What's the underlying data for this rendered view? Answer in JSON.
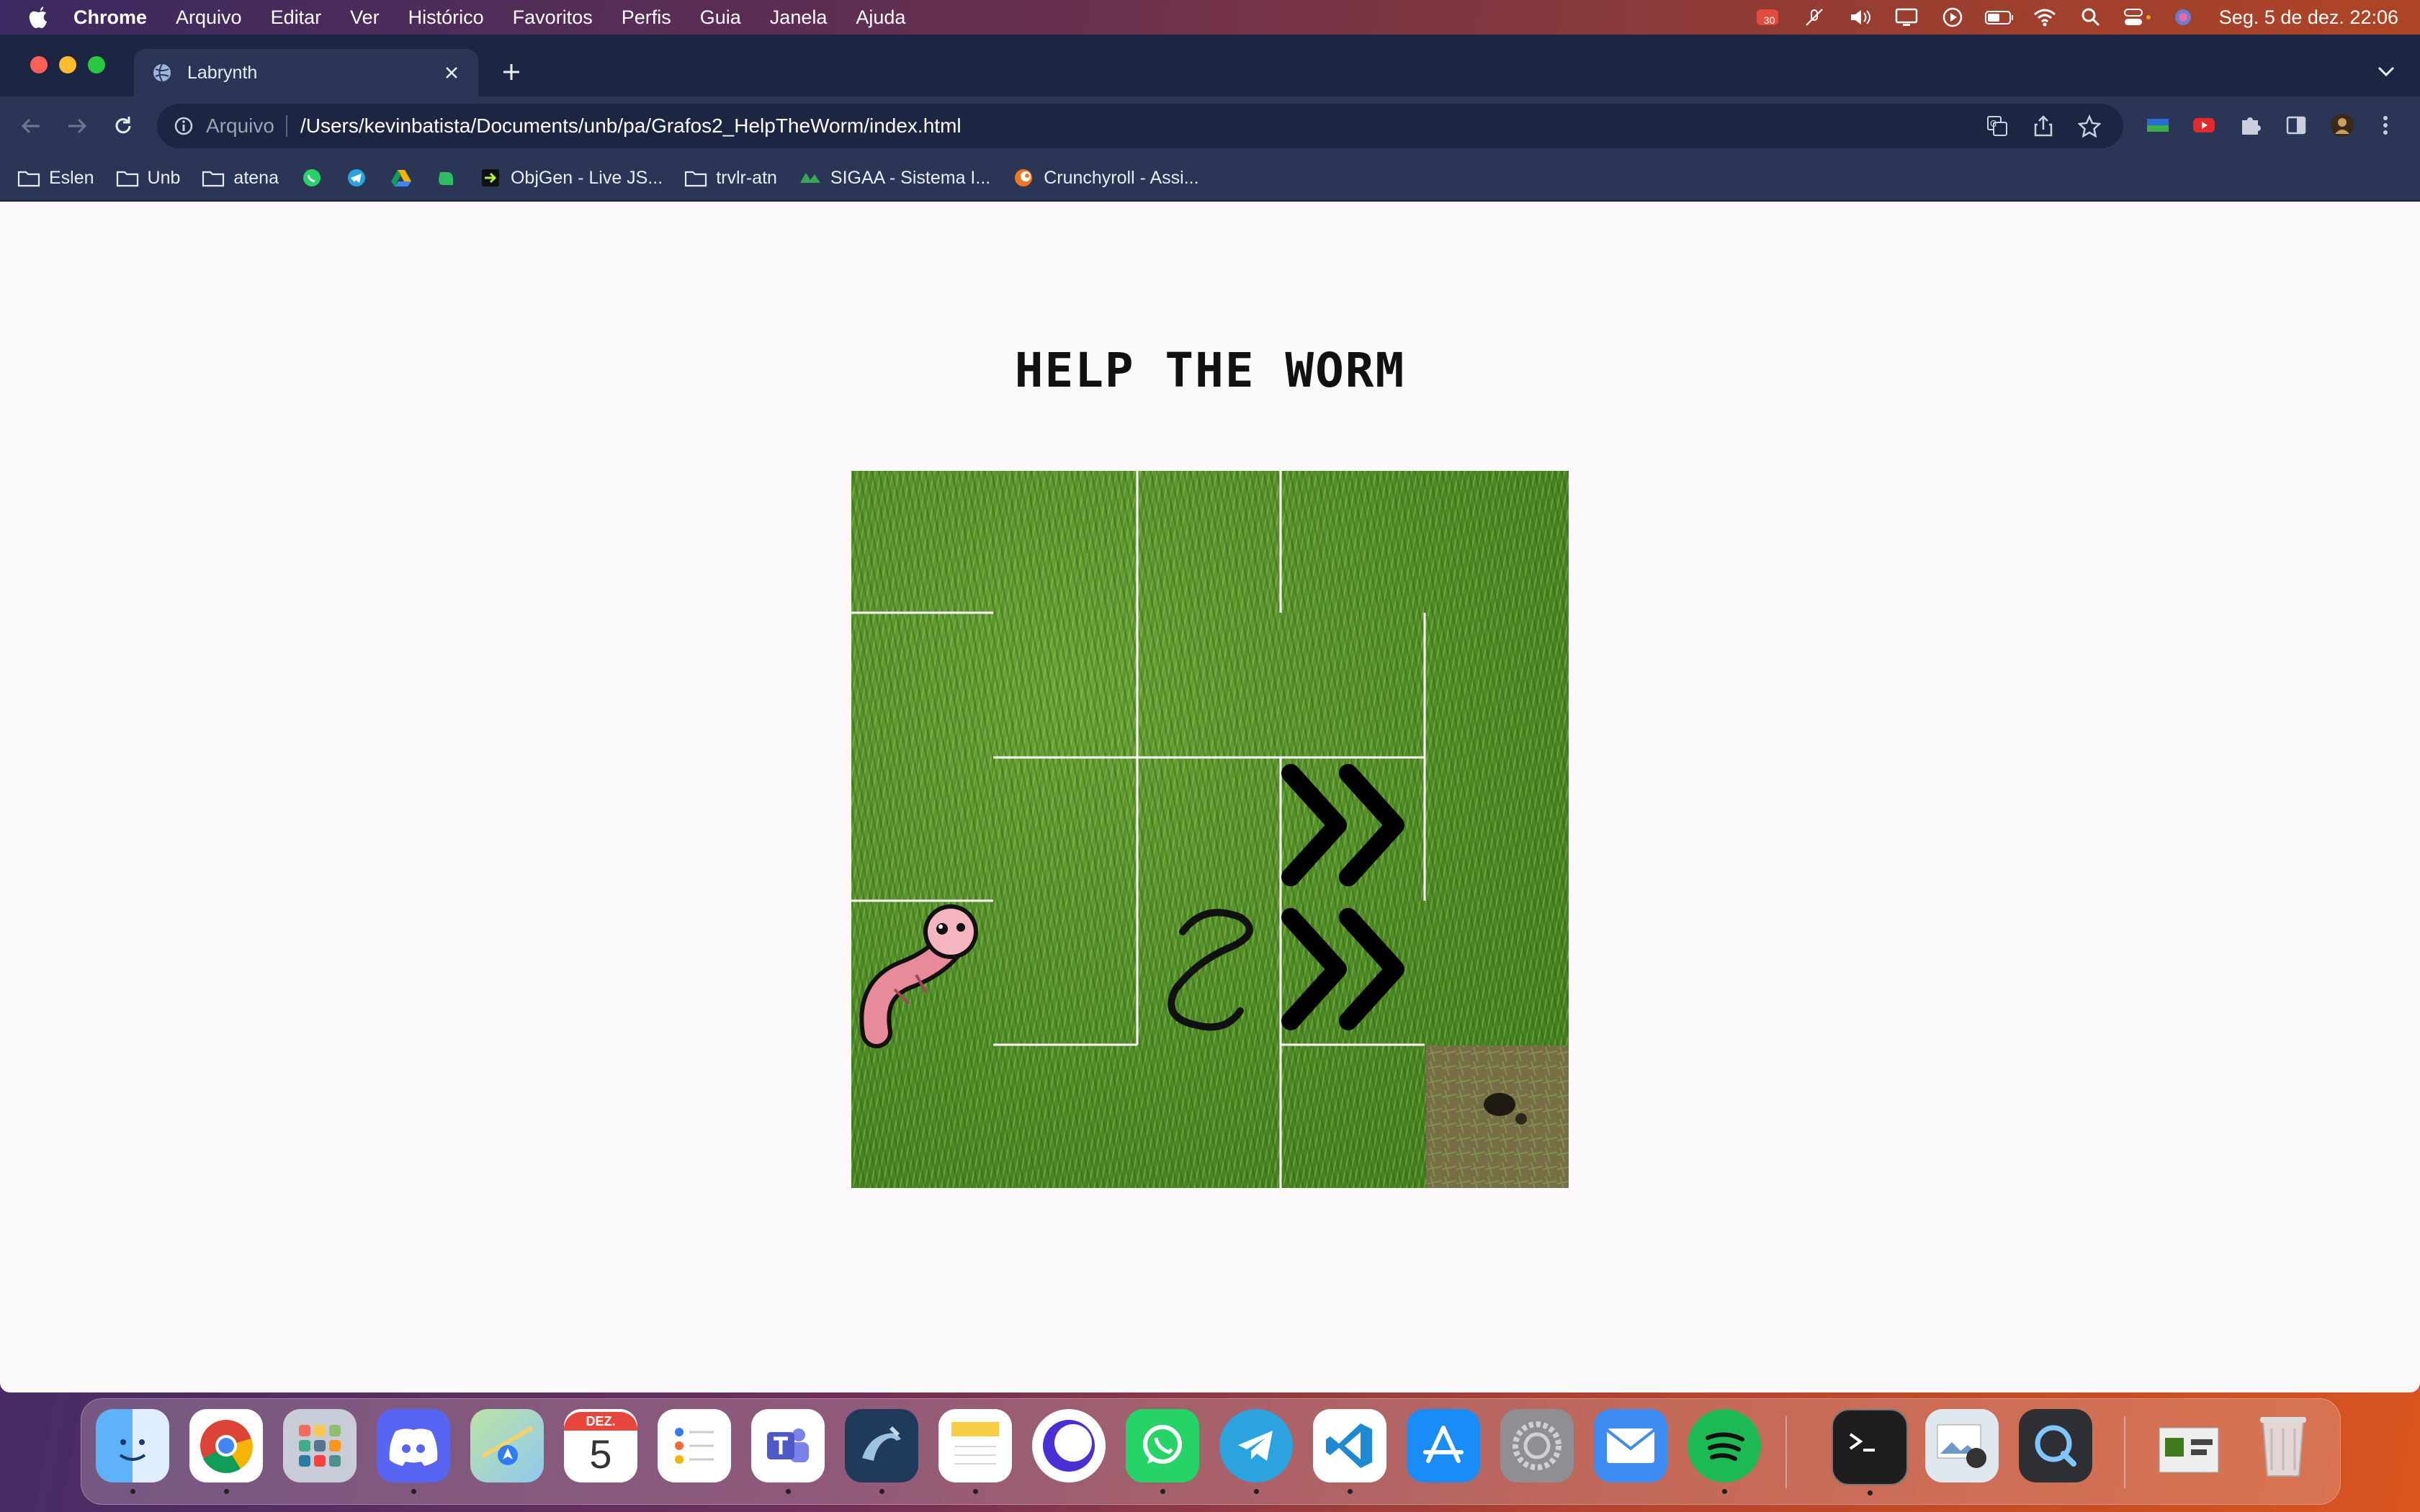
{
  "menubar": {
    "app_name": "Chrome",
    "items": [
      "Arquivo",
      "Editar",
      "Ver",
      "Histórico",
      "Favoritos",
      "Perfis",
      "Guia",
      "Janela",
      "Ajuda"
    ],
    "clock": "Seg. 5 de dez.  22:06",
    "badge_count": "30"
  },
  "browser": {
    "tab_title": "Labrynth",
    "url_scheme": "Arquivo",
    "url": "/Users/kevinbatista/Documents/unb/pa/Grafos2_HelpTheWorm/index.html",
    "bookmarks": [
      {
        "label": "Eslen",
        "icon": "folder-icon"
      },
      {
        "label": "Unb",
        "icon": "folder-icon"
      },
      {
        "label": "atena",
        "icon": "folder-icon"
      },
      {
        "label": "",
        "icon": "whatsapp-icon"
      },
      {
        "label": "",
        "icon": "telegram-icon"
      },
      {
        "label": "",
        "icon": "google-drive-icon"
      },
      {
        "label": "",
        "icon": "evernote-icon"
      },
      {
        "label": "ObjGen - Live JS...",
        "icon": "objgen-icon"
      },
      {
        "label": "trvlr-atn",
        "icon": "folder-icon"
      },
      {
        "label": "SIGAA - Sistema I...",
        "icon": "sigaa-icon"
      },
      {
        "label": "Crunchyroll - Assi...",
        "icon": "crunchyroll-icon"
      }
    ]
  },
  "page": {
    "title": "Help the worm",
    "maze": {
      "grid_size": 5,
      "player": "worm",
      "goal": "hole"
    }
  },
  "colors": {
    "tabstrip": "#1c2541",
    "toolbar": "#2b3656",
    "grass": "#4e8a26",
    "wall": "#ffffff"
  },
  "dock": {
    "apps": [
      "finder-icon",
      "chrome-icon",
      "launchpad-icon",
      "discord-icon",
      "maps-icon",
      "calendar-icon",
      "reminders-icon",
      "teams-icon",
      "mysql-workbench-icon",
      "notes-icon",
      "orion-icon",
      "whatsapp-icon",
      "telegram-icon",
      "vscode-icon",
      "app-store-icon",
      "system-preferences-icon",
      "mail-icon",
      "spotify-icon",
      "terminal-icon",
      "preview-icon",
      "quicktime-icon",
      "downloads-stack-icon",
      "trash-icon"
    ],
    "calendar_month": "DEZ.",
    "calendar_day": "5"
  }
}
